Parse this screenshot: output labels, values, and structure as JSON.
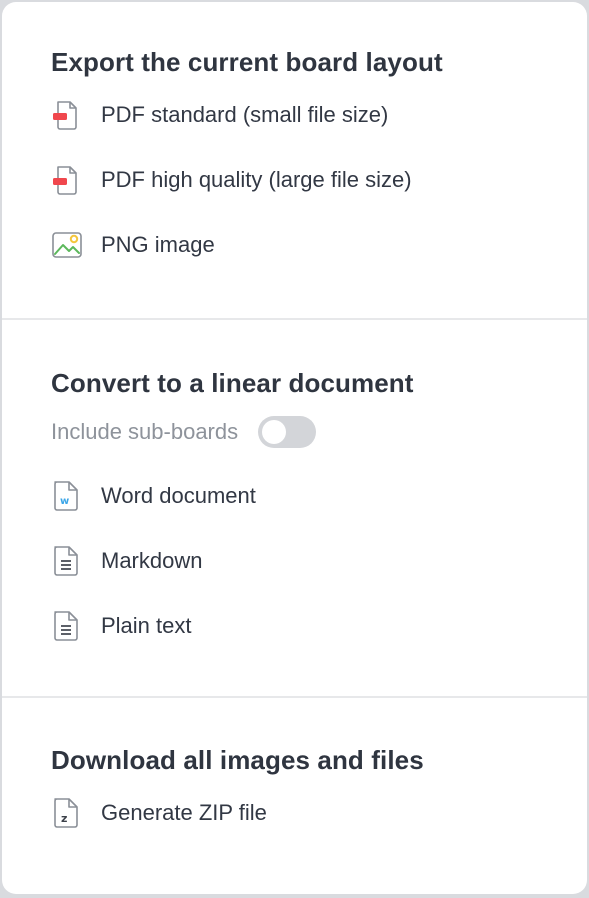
{
  "export_section": {
    "heading": "Export the current board layout",
    "items": [
      {
        "label": "PDF standard (small file size)",
        "icon": "pdf-file-icon"
      },
      {
        "label": "PDF high quality (large file size)",
        "icon": "pdf-file-icon"
      },
      {
        "label": "PNG image",
        "icon": "image-icon"
      }
    ]
  },
  "convert_section": {
    "heading": "Convert to a linear document",
    "toggle_label": "Include sub-boards",
    "toggle_on": false,
    "items": [
      {
        "label": "Word document",
        "icon": "word-file-icon"
      },
      {
        "label": "Markdown",
        "icon": "text-file-icon"
      },
      {
        "label": "Plain text",
        "icon": "text-file-icon"
      }
    ]
  },
  "download_section": {
    "heading": "Download all images and files",
    "items": [
      {
        "label": "Generate ZIP file",
        "icon": "zip-file-icon"
      }
    ]
  },
  "colors": {
    "pdf_accent": "#f0474d",
    "word_accent": "#3ba6e8",
    "image_green": "#5cb85c",
    "image_sun": "#f4c63d",
    "icon_outline": "#8a8f97"
  }
}
